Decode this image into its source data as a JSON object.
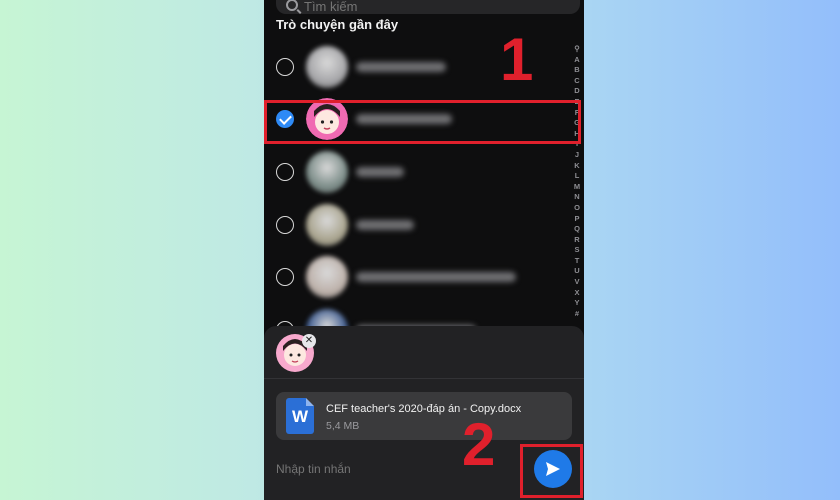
{
  "search": {
    "placeholder": "Tìm kiếm"
  },
  "section_title": "Trò chuyện gần đây",
  "contacts": [
    {
      "selected": false,
      "avatar_color": "#a5a5a8"
    },
    {
      "selected": true,
      "avatar_color": "#f06ab2"
    },
    {
      "selected": false,
      "avatar_color": "#7b8c88"
    },
    {
      "selected": false,
      "avatar_color": "#a9a48e"
    },
    {
      "selected": false,
      "avatar_color": "#bdb1aa"
    },
    {
      "selected": false,
      "avatar_color": "#3c5a8f"
    }
  ],
  "alphabet_index": [
    "A",
    "B",
    "C",
    "D",
    "E",
    "F",
    "G",
    "H",
    "I",
    "J",
    "K",
    "L",
    "M",
    "N",
    "O",
    "P",
    "Q",
    "R",
    "S",
    "T",
    "U",
    "V",
    "X",
    "Y",
    "#"
  ],
  "file": {
    "name": "CEF teacher's 2020-đáp án - Copy.docx",
    "size": "5,4 MB",
    "icon_letter": "W"
  },
  "message": {
    "placeholder": "Nhập tin nhắn"
  },
  "annotations": {
    "step1": "1",
    "step2": "2",
    "color": "#e0202c"
  },
  "colors": {
    "accent": "#1f7ae8",
    "checkbox": "#2e8af6"
  }
}
